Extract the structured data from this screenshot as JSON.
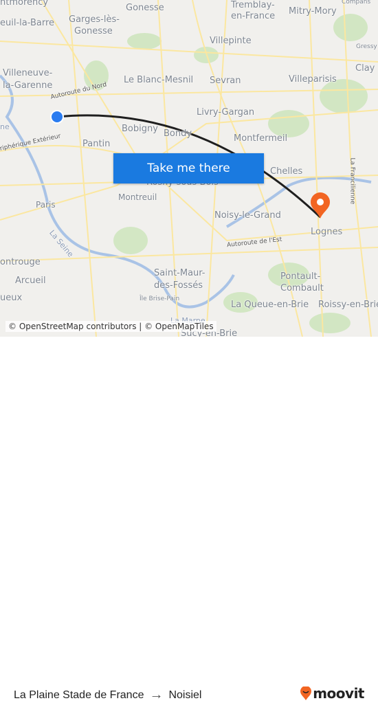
{
  "map": {
    "labels": [
      "ntmorency",
      "euil-la-Barre",
      "Garges-lès-",
      "Gonesse",
      "Gonesse",
      "Tremblay-",
      "en-France",
      "Mitry-Mory",
      "Compans",
      "Villepinte",
      "Gressy",
      "Clay",
      "Villeneuve-",
      "la-Garenne",
      "Le Blanc-Mesnil",
      "Sevran",
      "Villeparisis",
      "Autoroute du Nord",
      "Livry-Gargan",
      "Bobigny",
      "Bondy",
      "Montfermeil",
      "ne",
      "riphérique Extérieur",
      "Pantin",
      "Chelles",
      "La Francilienne",
      "Rosny-sous-Bois",
      "Montreuil",
      "Paris",
      "Noisy-le-Grand",
      "La Seine",
      "Autoroute de l'Est",
      "Lognes",
      "ontrouge",
      "Saint-Maur-",
      "des-Fossés",
      "Pontault-",
      "Combault",
      "Arcueil",
      "Île Brise-Pain",
      "La Queue-en-Brie",
      "Roissy-en-Brie",
      "ueux",
      "La Marne",
      "Sucy-en-Brie"
    ],
    "origin_color": "#2a7cf0",
    "destination_color": "#f26522",
    "route_color": "#1f1f1f"
  },
  "cta": {
    "label": "Take me there"
  },
  "attribution": "© OpenStreetMap contributors | © OpenMapTiles",
  "footer": {
    "origin": "La Plaine Stade de France",
    "arrow": "→",
    "destination": "Noisiel",
    "brand": "moovit"
  }
}
